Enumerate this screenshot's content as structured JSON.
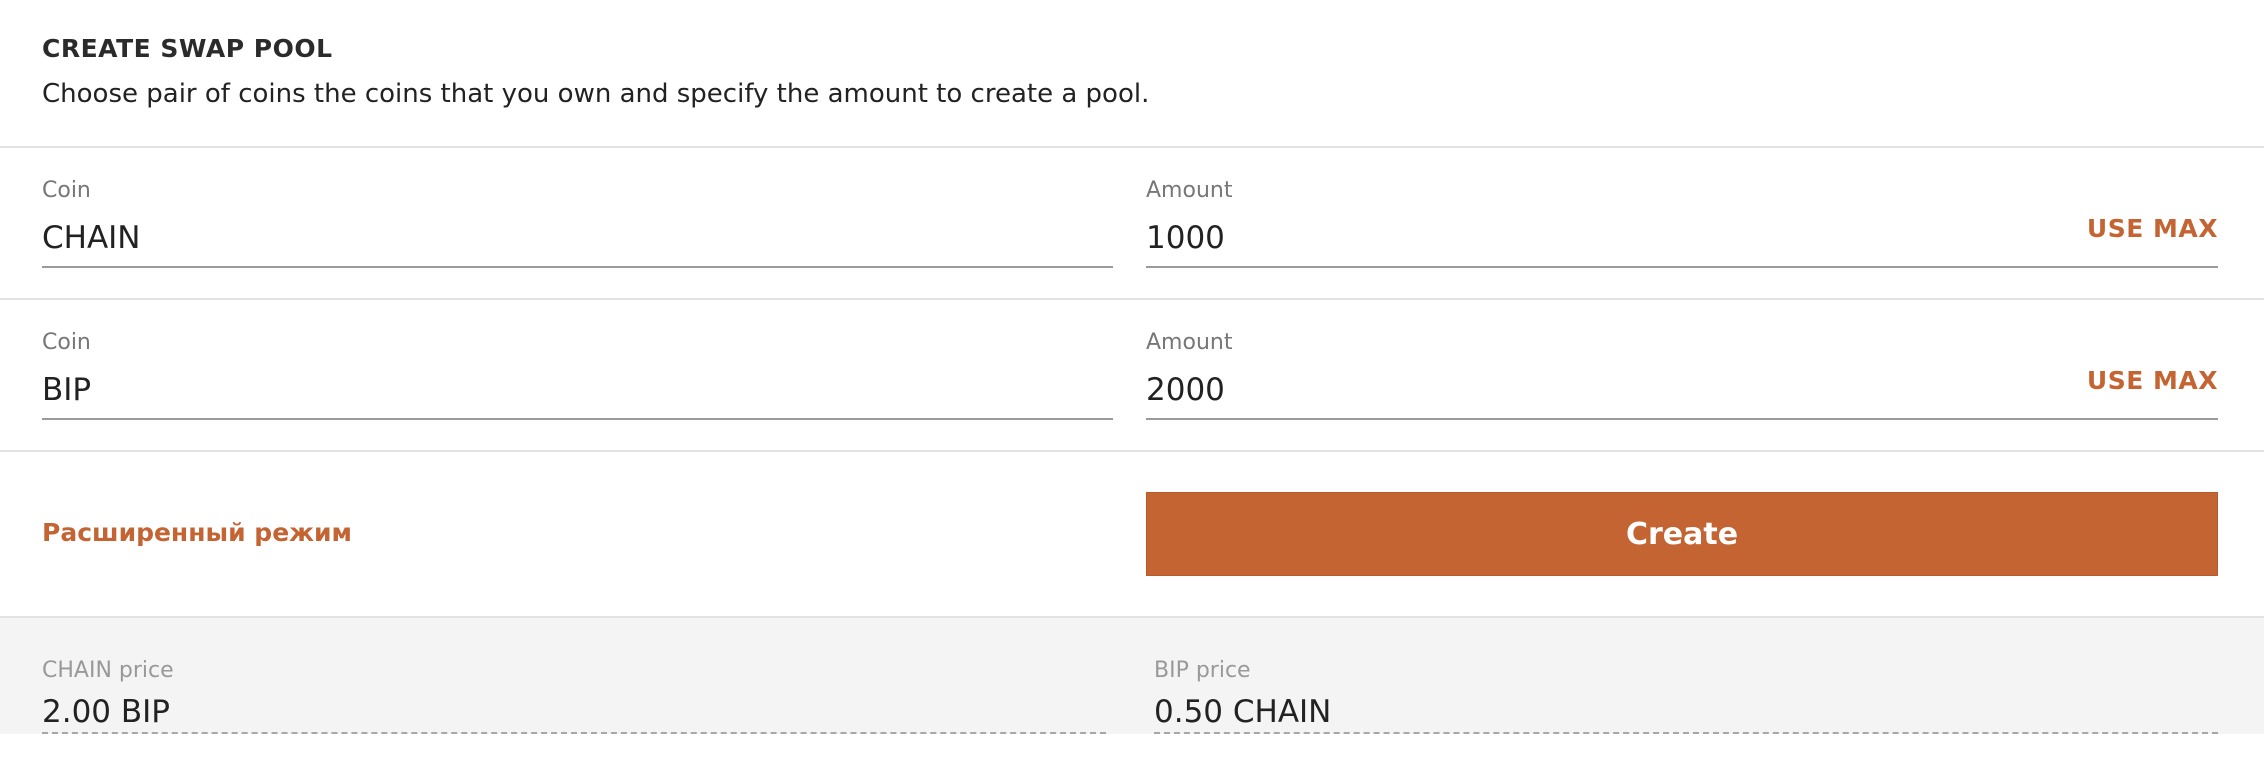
{
  "header": {
    "title": "CREATE SWAP POOL",
    "subtitle": "Choose pair of coins the coins that you own and specify the amount to create a pool."
  },
  "pair": [
    {
      "coin_label": "Coin",
      "coin_value": "CHAIN",
      "amount_label": "Amount",
      "amount_value": "1000",
      "use_max_label": "USE MAX"
    },
    {
      "coin_label": "Coin",
      "coin_value": "BIP",
      "amount_label": "Amount",
      "amount_value": "2000",
      "use_max_label": "USE MAX"
    }
  ],
  "actions": {
    "advanced_mode_label": "Расширенный режим",
    "create_label": "Create"
  },
  "prices": {
    "first_label": "CHAIN price",
    "first_value": "2.00 BIP",
    "second_label": "BIP price",
    "second_value": "0.50 CHAIN"
  },
  "colors": {
    "accent": "#c46433",
    "divider": "#e3e3e3",
    "price_background": "#f4f4f4"
  }
}
